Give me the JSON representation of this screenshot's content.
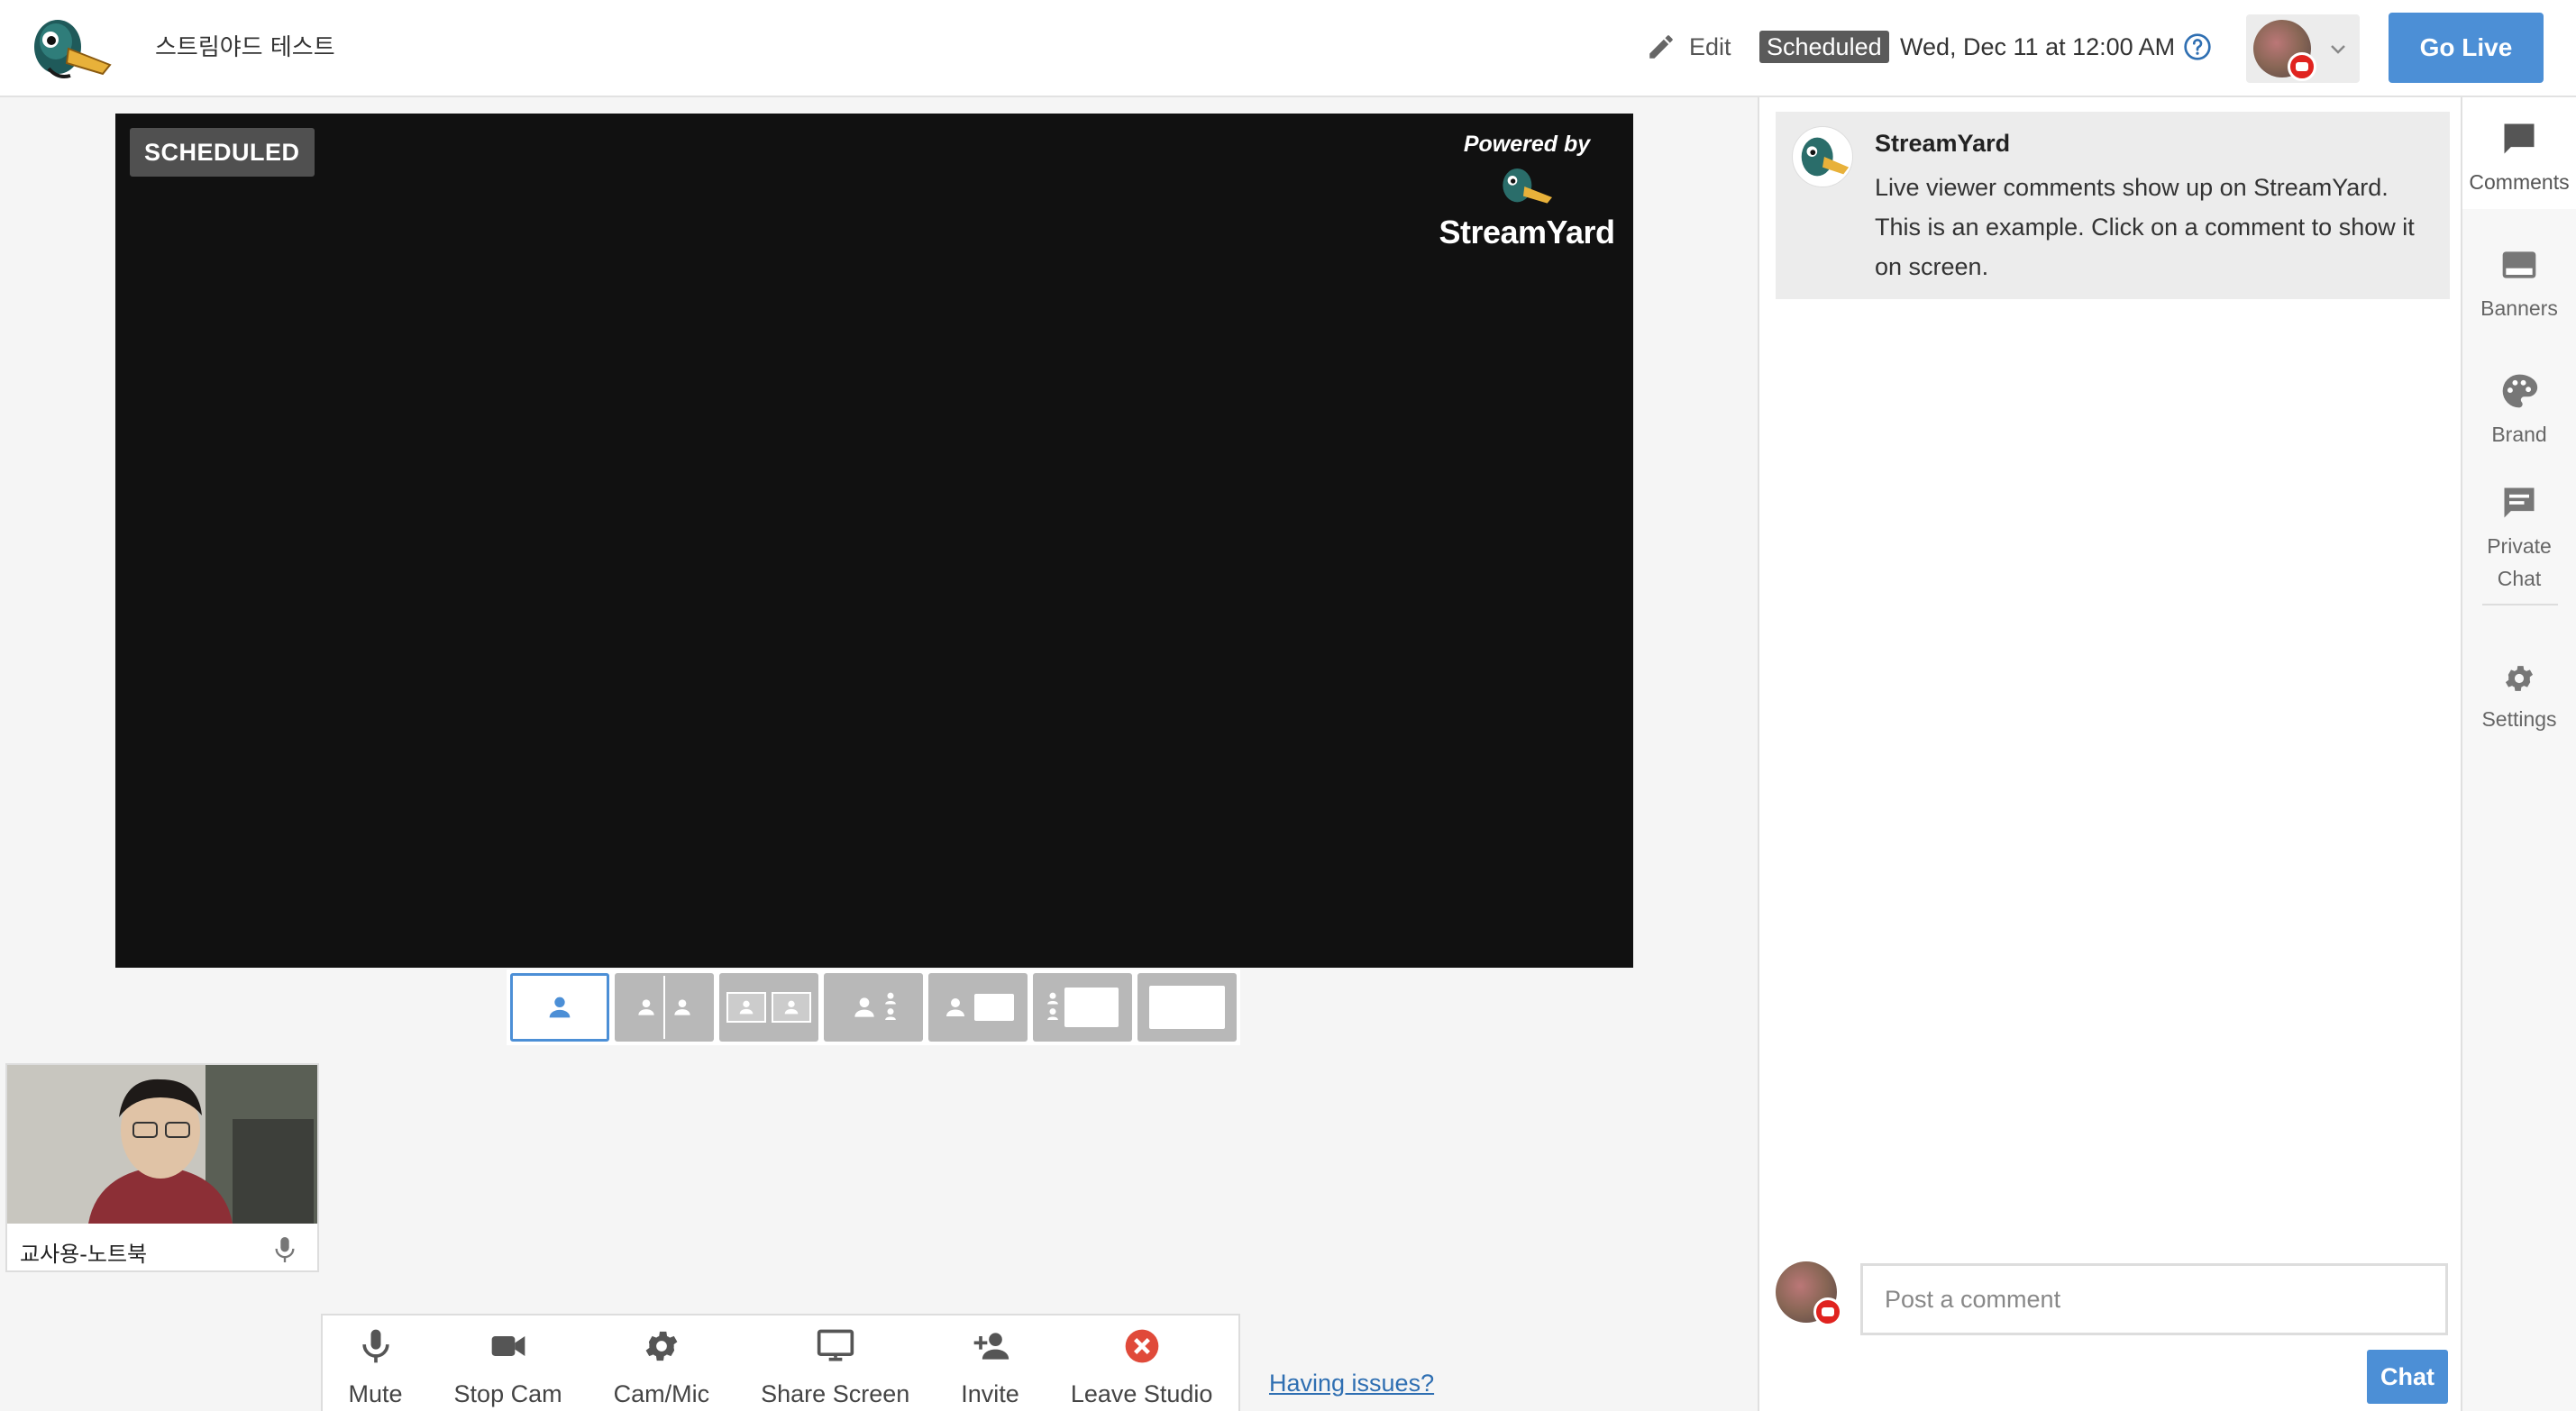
{
  "header": {
    "studio_title": "스트림야드 테스트",
    "edit_label": "Edit",
    "status_badge": "Scheduled",
    "schedule_date": "Wed, Dec 11 at 12:00 AM",
    "go_live_label": "Go Live"
  },
  "stage": {
    "status_badge": "SCHEDULED",
    "powered_by": "Powered by",
    "brand_name": "StreamYard"
  },
  "layouts": [
    {
      "name": "solo",
      "active": true
    },
    {
      "name": "cropped",
      "active": false
    },
    {
      "name": "group",
      "active": false
    },
    {
      "name": "leader",
      "active": false
    },
    {
      "name": "thin",
      "active": false
    },
    {
      "name": "news",
      "active": false
    },
    {
      "name": "fullscreen",
      "active": false
    }
  ],
  "preview": {
    "name": "교사용-노트북"
  },
  "toolbar": {
    "mute": "Mute",
    "stop_cam": "Stop Cam",
    "cam_mic": "Cam/Mic",
    "share_screen": "Share Screen",
    "invite": "Invite",
    "leave_studio": "Leave Studio",
    "having_issues": "Having issues?"
  },
  "comments": {
    "items": [
      {
        "author": "StreamYard",
        "text": "Live viewer comments show up on StreamYard. This is an example. Click on a comment to show it on screen."
      }
    ],
    "input_placeholder": "Post a comment",
    "chat_button": "Chat"
  },
  "rail": {
    "comments": "Comments",
    "banners": "Banners",
    "brand": "Brand",
    "private_chat": "Private Chat",
    "settings": "Settings"
  },
  "colors": {
    "accent": "#4c8fd6",
    "leave": "#e04a3a",
    "stage_bg": "#111111",
    "youtube": "#e0231f"
  },
  "icons": [
    "duck-logo-icon",
    "pencil-icon",
    "help-circle-icon",
    "chevron-down-icon",
    "mic-icon",
    "camera-icon",
    "gear-icon",
    "monitor-icon",
    "person-add-icon",
    "close-circle-icon",
    "comment-icon",
    "banner-icon",
    "palette-icon",
    "private-chat-icon",
    "settings-icon"
  ]
}
